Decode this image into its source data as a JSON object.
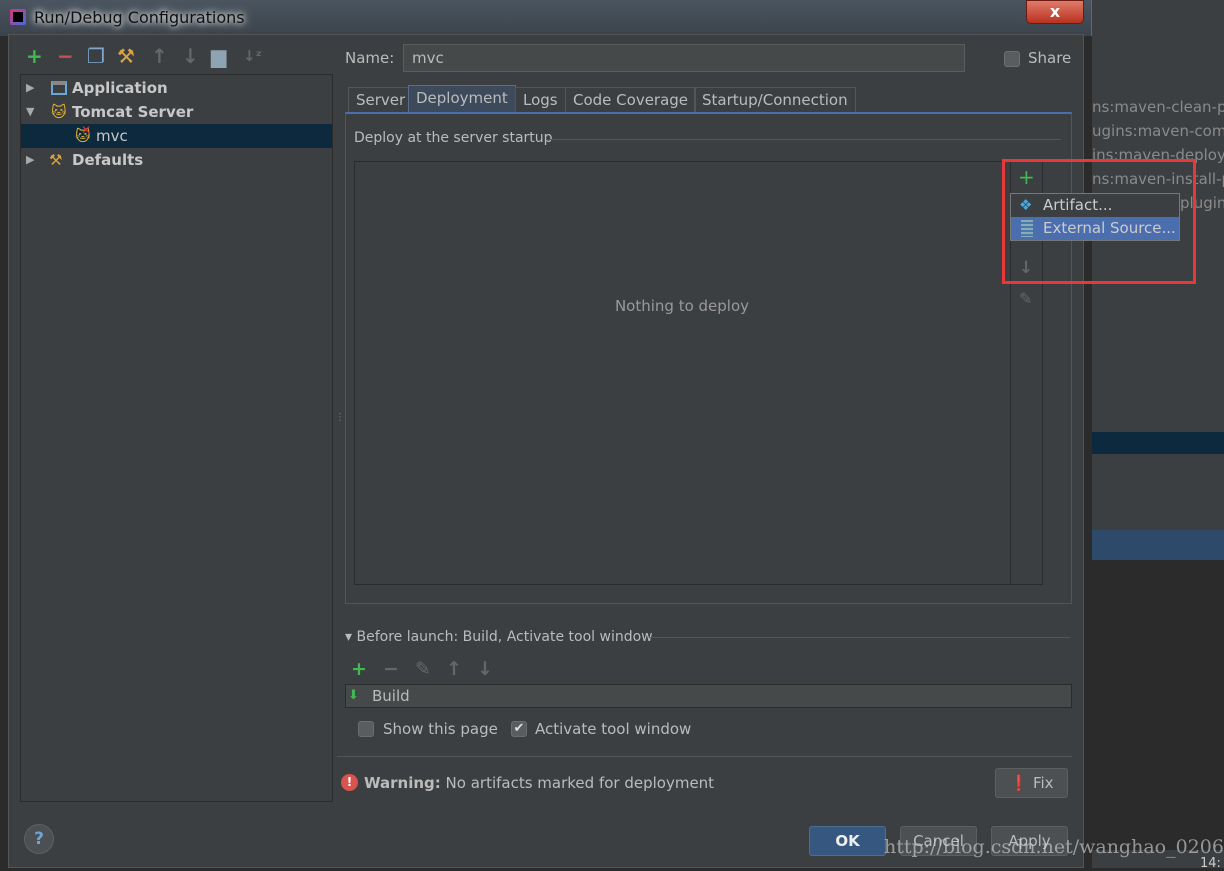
{
  "window": {
    "title": "Run/Debug Configurations",
    "close_label": "x"
  },
  "background_ide": {
    "lines": [
      "ns:maven-clean-plu",
      "ugins:maven-comp",
      "ins:maven-deploy",
      "ns:maven-install-pl",
      "plugin"
    ],
    "clock": "14:"
  },
  "toolbar": {
    "icons": [
      "add-icon",
      "remove-icon",
      "copy-icon",
      "edit-defaults-icon",
      "move-up-icon",
      "move-down-icon",
      "folder-icon",
      "sort-icon"
    ]
  },
  "tree": {
    "items": [
      {
        "label": "Application",
        "expanded": false
      },
      {
        "label": "Tomcat Server",
        "expanded": true
      },
      {
        "label": "mvc",
        "selected": true
      },
      {
        "label": "Defaults",
        "expanded": false
      }
    ]
  },
  "form": {
    "name_label": "Name:",
    "name_value": "mvc",
    "share_label": "Share",
    "share_checked": false
  },
  "tabs": [
    {
      "label": "Server"
    },
    {
      "label": "Deployment",
      "active": true
    },
    {
      "label": "Logs"
    },
    {
      "label": "Code Coverage"
    },
    {
      "label": "Startup/Connection"
    }
  ],
  "deployment": {
    "section_title": "Deploy at the server startup",
    "empty_text": "Nothing to deploy"
  },
  "popup": {
    "items": [
      {
        "label": "Artifact..."
      },
      {
        "label": "External Source...",
        "selected": true
      }
    ]
  },
  "before_launch": {
    "title": "Before launch: Build, Activate tool window",
    "items": [
      "Build"
    ],
    "show_page_label": "Show this page",
    "show_page_checked": false,
    "activate_label": "Activate tool window",
    "activate_checked": true
  },
  "warning": {
    "label": "Warning:",
    "text": "No artifacts marked for deployment",
    "fix_label": "Fix"
  },
  "buttons": {
    "ok": "OK",
    "cancel": "Cancel",
    "apply": "Apply",
    "help": "?"
  },
  "watermark": "http://blog.csdn.net/wanghao_0206",
  "colors": {
    "background": "#3c3f41",
    "selection": "#0d293e",
    "accent": "#4b6eaf",
    "add": "#3fb950",
    "remove": "#c75450",
    "highlight": "#e8383a"
  }
}
